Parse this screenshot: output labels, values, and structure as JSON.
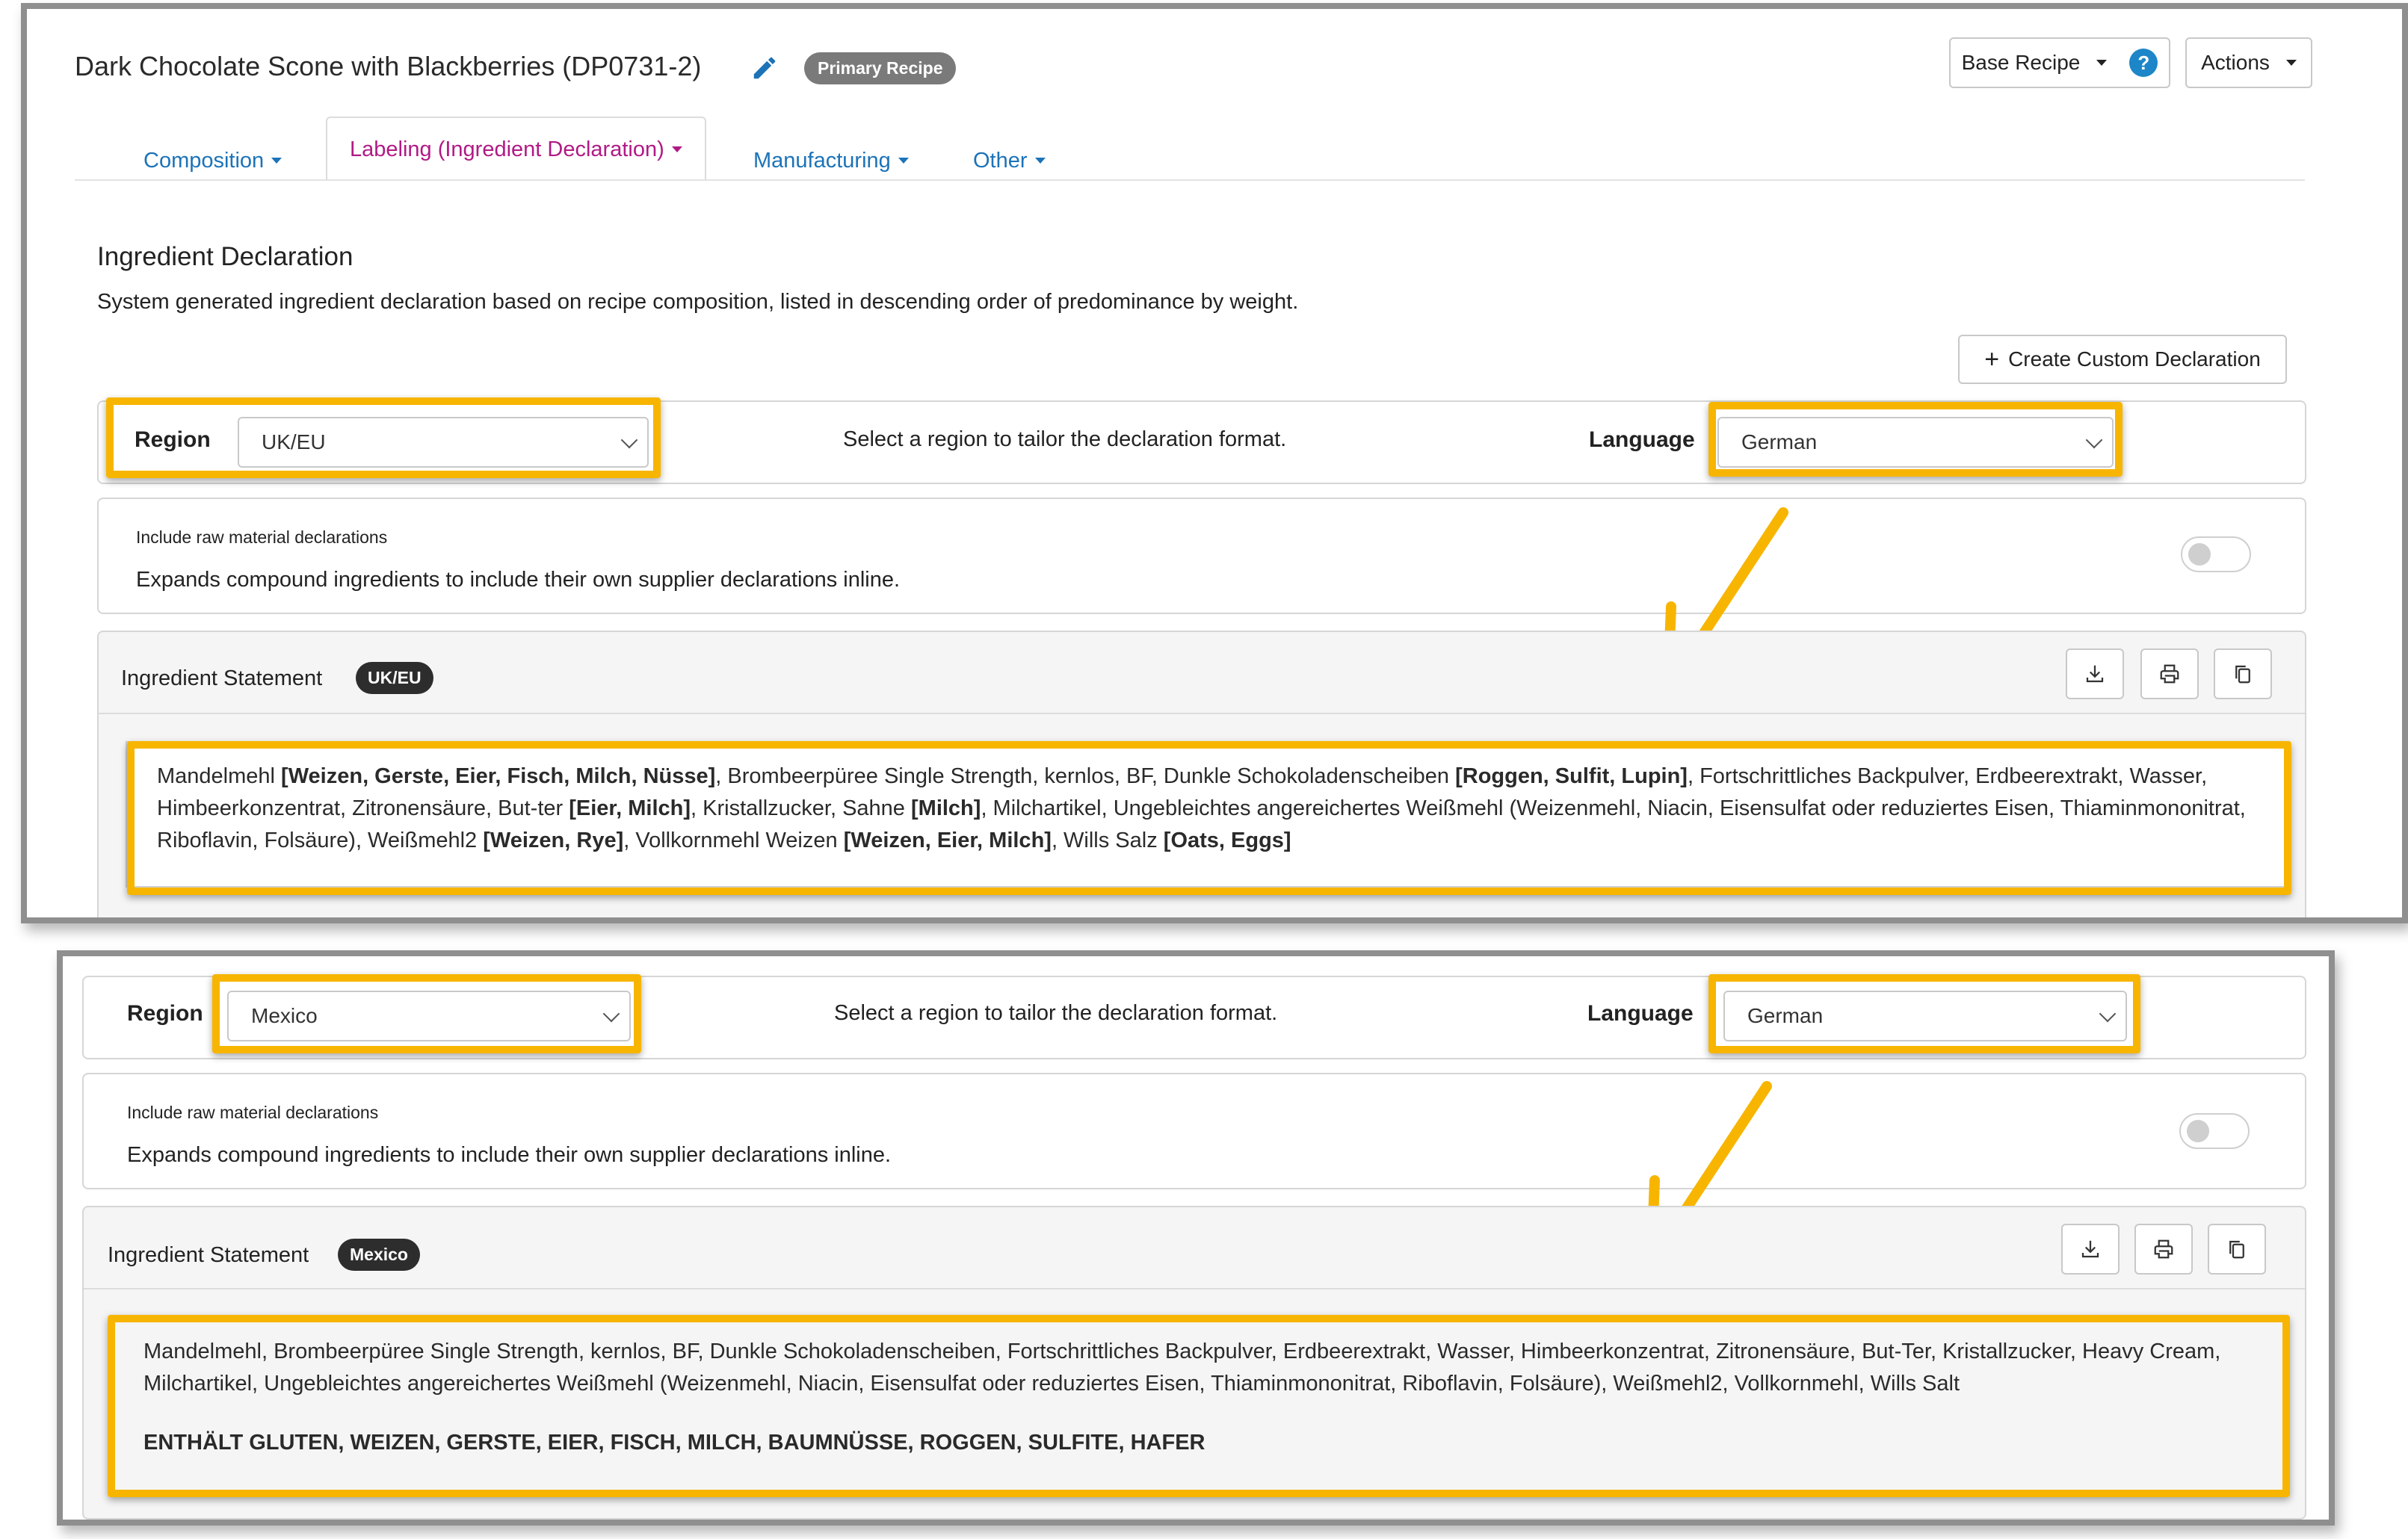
{
  "header": {
    "recipe_title": "Dark Chocolate Scone with Blackberries (DP0731-2)",
    "primary_badge": "Primary Recipe",
    "base_recipe_label": "Base Recipe",
    "actions_label": "Actions",
    "help_glyph": "?"
  },
  "tabs": [
    {
      "label": "Composition"
    },
    {
      "label": "Labeling (Ingredient Declaration)"
    },
    {
      "label": "Manufacturing"
    },
    {
      "label": "Other"
    }
  ],
  "section": {
    "title": "Ingredient Declaration",
    "description": "System generated ingredient declaration based on recipe composition, listed in descending order of predominance by weight.",
    "create_custom_label": "Create Custom Declaration"
  },
  "colors": {
    "highlight": "#f7b500",
    "tab_active": "#b01a85",
    "tab_link": "#1c73b8"
  },
  "panel_uk": {
    "region_label": "Region",
    "region_value": "UK/EU",
    "region_hint": "Select a region to tailor the declaration format.",
    "language_label": "Language",
    "language_value": "German",
    "raw_title": "Include raw material declarations",
    "raw_desc": "Expands compound ingredients to include their own supplier declarations inline.",
    "statement_label": "Ingredient Statement",
    "statement_badge": "UK/EU",
    "statement_segments": [
      {
        "t": "Mandelmehl ",
        "b": false
      },
      {
        "t": "[Weizen, Gerste, Eier, Fisch, Milch, Nüsse]",
        "b": true
      },
      {
        "t": ", Brombeerpüree Single Strength, kernlos, BF, Dunkle Schokoladenscheiben ",
        "b": false
      },
      {
        "t": "[Roggen, Sulfit, Lupin]",
        "b": true
      },
      {
        "t": ", Fortschrittliches Backpulver, Erdbeerextrakt, Wasser, Himbeerkonzentrat, Zitronensäure, But-ter ",
        "b": false
      },
      {
        "t": "[Eier, Milch]",
        "b": true
      },
      {
        "t": ", Kristallzucker, Sahne ",
        "b": false
      },
      {
        "t": "[Milch]",
        "b": true
      },
      {
        "t": ", Milchartikel, Ungebleichtes angereichertes Weißmehl (Weizenmehl, Niacin, Eisensulfat oder reduziertes Eisen, Thiaminmononitrat, Riboflavin, Folsäure), Weißmehl2 ",
        "b": false
      },
      {
        "t": "[Weizen, Rye]",
        "b": true
      },
      {
        "t": ", Vollkornmehl Weizen ",
        "b": false
      },
      {
        "t": "[Weizen, Eier, Milch]",
        "b": true
      },
      {
        "t": ", Wills Salz ",
        "b": false
      },
      {
        "t": "[Oats, Eggs]",
        "b": true
      }
    ]
  },
  "panel_mx": {
    "region_label": "Region",
    "region_value": "Mexico",
    "region_hint": "Select a region to tailor the declaration format.",
    "language_label": "Language",
    "language_value": "German",
    "raw_title": "Include raw material declarations",
    "raw_desc": "Expands compound ingredients to include their own supplier declarations inline.",
    "statement_label": "Ingredient Statement",
    "statement_badge": "Mexico",
    "statement_text": "Mandelmehl, Brombeerpüree Single Strength, kernlos, BF, Dunkle Schokoladenscheiben, Fortschrittliches Backpulver, Erdbeerextrakt, Wasser, Himbeerkonzentrat, Zitronensäure, But-Ter, Kristallzucker, Heavy Cream, Milchartikel, Ungebleichtes angereichertes Weißmehl (Weizenmehl, Niacin, Eisensulfat oder reduziertes Eisen, Thiaminmononitrat, Riboflavin, Folsäure), Weißmehl2, Vollkornmehl, Wills Salt",
    "contains_text": "ENTHÄLT GLUTEN, WEIZEN, GERSTE, EIER, FISCH, MILCH, BAUMNÜSSE, ROGGEN, SULFITE, HAFER"
  }
}
